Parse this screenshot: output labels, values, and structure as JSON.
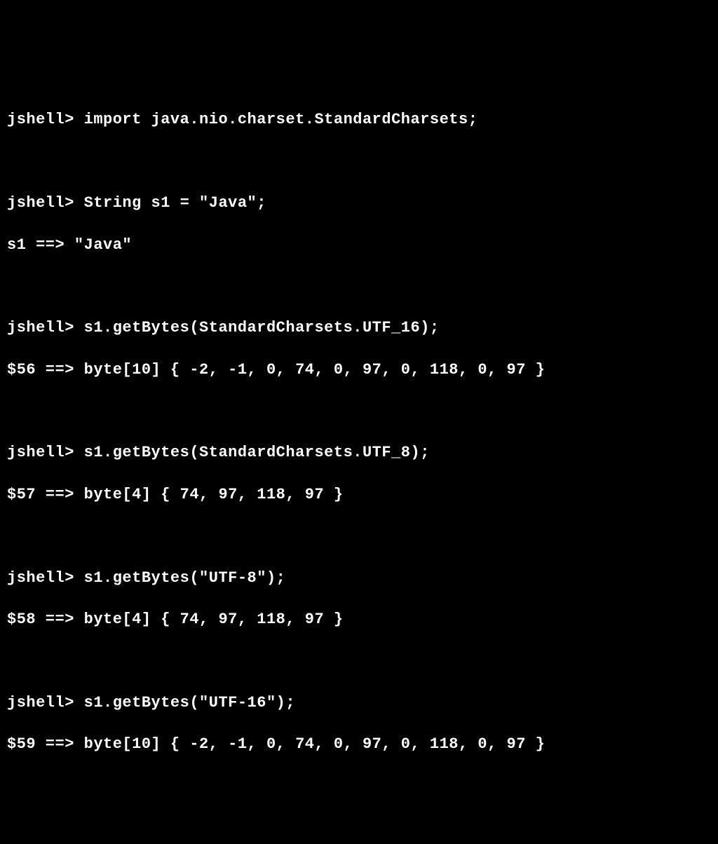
{
  "terminal": {
    "lines": {
      "l1": "jshell> import java.nio.charset.StandardCharsets;",
      "l2": "",
      "l3": "jshell> String s1 = \"Java\";",
      "l4": "s1 ==> \"Java\"",
      "l5": "",
      "l6": "jshell> s1.getBytes(StandardCharsets.UTF_16);",
      "l7": "$56 ==> byte[10] { -2, -1, 0, 74, 0, 97, 0, 118, 0, 97 }",
      "l8": "",
      "l9": "jshell> s1.getBytes(StandardCharsets.UTF_8);",
      "l10": "$57 ==> byte[4] { 74, 97, 118, 97 }",
      "l11": "",
      "l12": "jshell> s1.getBytes(\"UTF-8\");",
      "l13": "$58 ==> byte[4] { 74, 97, 118, 97 }",
      "l14": "",
      "l15": "jshell> s1.getBytes(\"UTF-16\");",
      "l16": "$59 ==> byte[10] { -2, -1, 0, 74, 0, 97, 0, 118, 0, 97 }"
    }
  }
}
